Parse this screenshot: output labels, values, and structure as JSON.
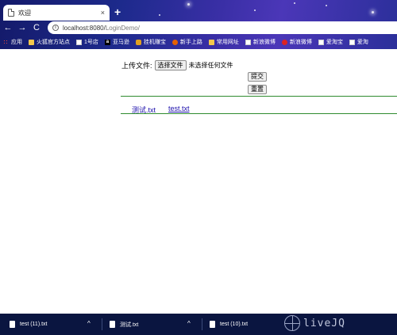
{
  "browser": {
    "tab_title": "欢迎",
    "tab_close": "×",
    "new_tab": "+",
    "nav": {
      "back": "←",
      "forward": "→",
      "reload": "C"
    },
    "url_host": "localhost:8080/",
    "url_path": "LoginDemo/",
    "bookmarks": [
      {
        "label": "应用",
        "icon": "apps-icon"
      },
      {
        "label": "火狐官方站点",
        "icon": "folder-icon"
      },
      {
        "label": "1号店",
        "icon": "page-icon"
      },
      {
        "label": "亚马逊",
        "icon": "amazon-icon"
      },
      {
        "label": "挂机赚宝",
        "icon": "hand-icon"
      },
      {
        "label": "新手上路",
        "icon": "firefox-icon"
      },
      {
        "label": "常用网址",
        "icon": "folder-icon"
      },
      {
        "label": "新浪微博",
        "icon": "page-icon"
      },
      {
        "label": "新浪微博",
        "icon": "weibo-icon"
      },
      {
        "label": "爱淘宝",
        "icon": "page-icon"
      },
      {
        "label": "爱淘",
        "icon": "page-icon"
      }
    ]
  },
  "page": {
    "upload_label": "上传文件:",
    "choose_file_button": "选择文件",
    "no_file_text": "未选择任何文件",
    "submit_button": "提交",
    "reset_button": "重置",
    "files": [
      "测试.txt",
      "test.txt"
    ]
  },
  "taskbar": {
    "items": [
      {
        "label": "test (11).txt",
        "chevron": "^"
      },
      {
        "label": "测试.txt",
        "chevron": "^"
      },
      {
        "label": "test (10).txt",
        "chevron": ""
      }
    ],
    "watermark": "liveJQ"
  }
}
